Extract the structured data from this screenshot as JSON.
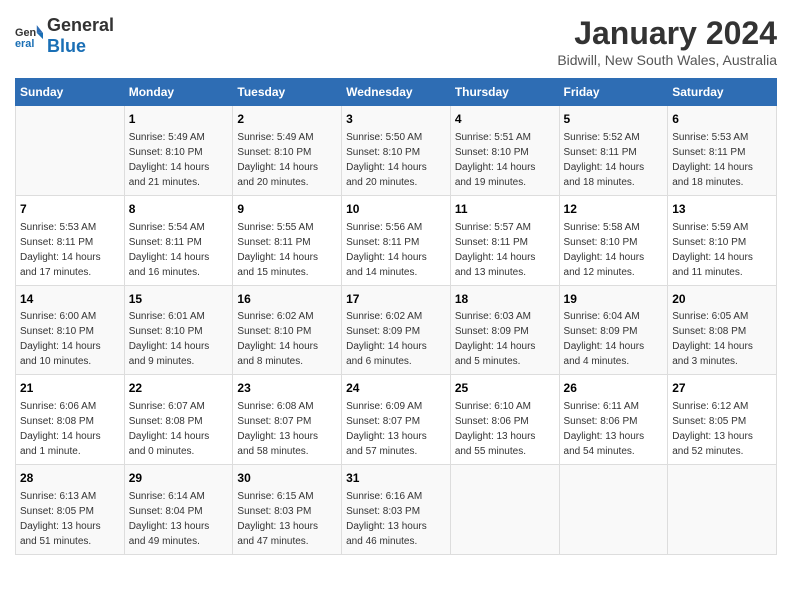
{
  "header": {
    "logo_general": "General",
    "logo_blue": "Blue",
    "main_title": "January 2024",
    "subtitle": "Bidwill, New South Wales, Australia"
  },
  "calendar": {
    "days_of_week": [
      "Sunday",
      "Monday",
      "Tuesday",
      "Wednesday",
      "Thursday",
      "Friday",
      "Saturday"
    ],
    "weeks": [
      [
        {
          "day": "",
          "info": ""
        },
        {
          "day": "1",
          "info": "Sunrise: 5:49 AM\nSunset: 8:10 PM\nDaylight: 14 hours\nand 21 minutes."
        },
        {
          "day": "2",
          "info": "Sunrise: 5:49 AM\nSunset: 8:10 PM\nDaylight: 14 hours\nand 20 minutes."
        },
        {
          "day": "3",
          "info": "Sunrise: 5:50 AM\nSunset: 8:10 PM\nDaylight: 14 hours\nand 20 minutes."
        },
        {
          "day": "4",
          "info": "Sunrise: 5:51 AM\nSunset: 8:10 PM\nDaylight: 14 hours\nand 19 minutes."
        },
        {
          "day": "5",
          "info": "Sunrise: 5:52 AM\nSunset: 8:11 PM\nDaylight: 14 hours\nand 18 minutes."
        },
        {
          "day": "6",
          "info": "Sunrise: 5:53 AM\nSunset: 8:11 PM\nDaylight: 14 hours\nand 18 minutes."
        }
      ],
      [
        {
          "day": "7",
          "info": "Sunrise: 5:53 AM\nSunset: 8:11 PM\nDaylight: 14 hours\nand 17 minutes."
        },
        {
          "day": "8",
          "info": "Sunrise: 5:54 AM\nSunset: 8:11 PM\nDaylight: 14 hours\nand 16 minutes."
        },
        {
          "day": "9",
          "info": "Sunrise: 5:55 AM\nSunset: 8:11 PM\nDaylight: 14 hours\nand 15 minutes."
        },
        {
          "day": "10",
          "info": "Sunrise: 5:56 AM\nSunset: 8:11 PM\nDaylight: 14 hours\nand 14 minutes."
        },
        {
          "day": "11",
          "info": "Sunrise: 5:57 AM\nSunset: 8:11 PM\nDaylight: 14 hours\nand 13 minutes."
        },
        {
          "day": "12",
          "info": "Sunrise: 5:58 AM\nSunset: 8:10 PM\nDaylight: 14 hours\nand 12 minutes."
        },
        {
          "day": "13",
          "info": "Sunrise: 5:59 AM\nSunset: 8:10 PM\nDaylight: 14 hours\nand 11 minutes."
        }
      ],
      [
        {
          "day": "14",
          "info": "Sunrise: 6:00 AM\nSunset: 8:10 PM\nDaylight: 14 hours\nand 10 minutes."
        },
        {
          "day": "15",
          "info": "Sunrise: 6:01 AM\nSunset: 8:10 PM\nDaylight: 14 hours\nand 9 minutes."
        },
        {
          "day": "16",
          "info": "Sunrise: 6:02 AM\nSunset: 8:10 PM\nDaylight: 14 hours\nand 8 minutes."
        },
        {
          "day": "17",
          "info": "Sunrise: 6:02 AM\nSunset: 8:09 PM\nDaylight: 14 hours\nand 6 minutes."
        },
        {
          "day": "18",
          "info": "Sunrise: 6:03 AM\nSunset: 8:09 PM\nDaylight: 14 hours\nand 5 minutes."
        },
        {
          "day": "19",
          "info": "Sunrise: 6:04 AM\nSunset: 8:09 PM\nDaylight: 14 hours\nand 4 minutes."
        },
        {
          "day": "20",
          "info": "Sunrise: 6:05 AM\nSunset: 8:08 PM\nDaylight: 14 hours\nand 3 minutes."
        }
      ],
      [
        {
          "day": "21",
          "info": "Sunrise: 6:06 AM\nSunset: 8:08 PM\nDaylight: 14 hours\nand 1 minute."
        },
        {
          "day": "22",
          "info": "Sunrise: 6:07 AM\nSunset: 8:08 PM\nDaylight: 14 hours\nand 0 minutes."
        },
        {
          "day": "23",
          "info": "Sunrise: 6:08 AM\nSunset: 8:07 PM\nDaylight: 13 hours\nand 58 minutes."
        },
        {
          "day": "24",
          "info": "Sunrise: 6:09 AM\nSunset: 8:07 PM\nDaylight: 13 hours\nand 57 minutes."
        },
        {
          "day": "25",
          "info": "Sunrise: 6:10 AM\nSunset: 8:06 PM\nDaylight: 13 hours\nand 55 minutes."
        },
        {
          "day": "26",
          "info": "Sunrise: 6:11 AM\nSunset: 8:06 PM\nDaylight: 13 hours\nand 54 minutes."
        },
        {
          "day": "27",
          "info": "Sunrise: 6:12 AM\nSunset: 8:05 PM\nDaylight: 13 hours\nand 52 minutes."
        }
      ],
      [
        {
          "day": "28",
          "info": "Sunrise: 6:13 AM\nSunset: 8:05 PM\nDaylight: 13 hours\nand 51 minutes."
        },
        {
          "day": "29",
          "info": "Sunrise: 6:14 AM\nSunset: 8:04 PM\nDaylight: 13 hours\nand 49 minutes."
        },
        {
          "day": "30",
          "info": "Sunrise: 6:15 AM\nSunset: 8:03 PM\nDaylight: 13 hours\nand 47 minutes."
        },
        {
          "day": "31",
          "info": "Sunrise: 6:16 AM\nSunset: 8:03 PM\nDaylight: 13 hours\nand 46 minutes."
        },
        {
          "day": "",
          "info": ""
        },
        {
          "day": "",
          "info": ""
        },
        {
          "day": "",
          "info": ""
        }
      ]
    ]
  }
}
